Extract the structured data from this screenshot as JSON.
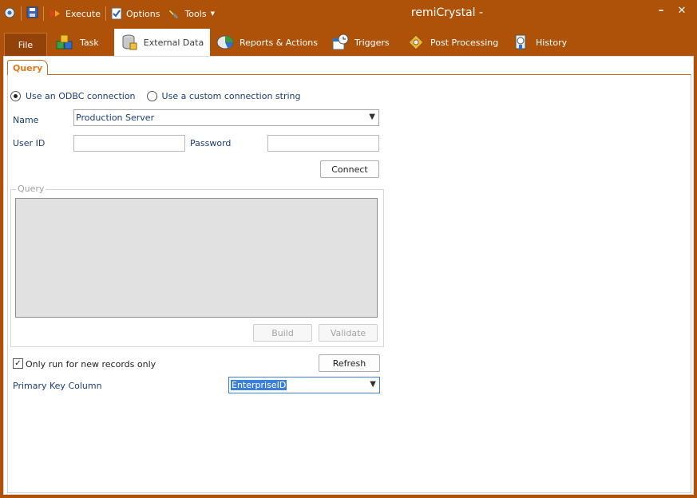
{
  "window": {
    "title": "remiCrystal -",
    "minimize_glyph": "–",
    "close_glyph": "✕"
  },
  "qat": {
    "execute_label": "Execute",
    "options_label": "Options",
    "tools_label": "Tools"
  },
  "tabs": [
    {
      "label": "File"
    },
    {
      "label": "Task"
    },
    {
      "label": "External Data"
    },
    {
      "label": "Reports & Actions"
    },
    {
      "label": "Triggers"
    },
    {
      "label": "Post Processing"
    },
    {
      "label": "History"
    }
  ],
  "subtab": {
    "label": "Query"
  },
  "connection": {
    "odbc_label": "Use an ODBC connection",
    "custom_label": "Use a custom connection string",
    "selected": "odbc",
    "name_label": "Name",
    "name_value": "Production Server",
    "userid_label": "User ID",
    "userid_value": "",
    "password_label": "Password",
    "password_value": "",
    "connect_label": "Connect"
  },
  "query": {
    "legend": "Query",
    "text": "",
    "build_label": "Build",
    "validate_label": "Validate"
  },
  "options": {
    "new_records_label": "Only run for new records only",
    "new_records_checked": true,
    "check_glyph": "✓",
    "refresh_label": "Refresh",
    "pk_label": "Primary Key Column",
    "pk_value": "EnterpriseID"
  },
  "colors": {
    "accent": "#ad5208",
    "label_blue": "#1a3e7c",
    "subtab_orange": "#e07b19"
  }
}
